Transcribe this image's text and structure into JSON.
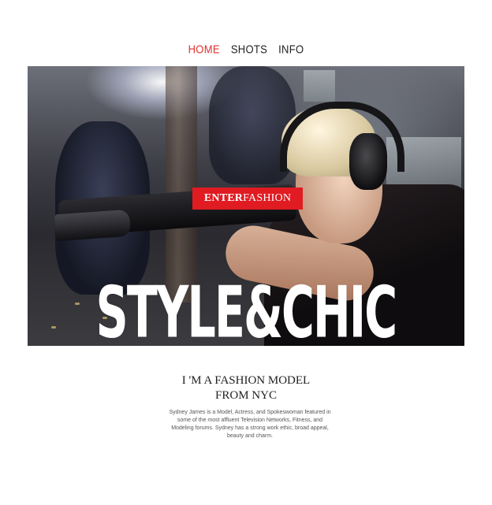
{
  "nav": {
    "items": [
      {
        "label": "HOME",
        "active": true
      },
      {
        "label": "SHOTS",
        "active": false
      },
      {
        "label": "INFO",
        "active": false
      }
    ]
  },
  "hero": {
    "enter_strong": "ENTER",
    "enter_light": "FASHION",
    "title": "STYLE&CHIC"
  },
  "intro": {
    "line1": "I 'M A FASHION MODEL",
    "line2": "FROM NYC",
    "bio": "Sydney James is a Model, Actress, and Spokeswoman featured in some of the most affluent Television Networks, Fitness, and Modeling forums. Sydney has a strong work ethic, broad appeal, beauty and charm."
  },
  "colors": {
    "accent": "#e11b22",
    "nav_active": "#e0312f",
    "text": "#222222"
  }
}
